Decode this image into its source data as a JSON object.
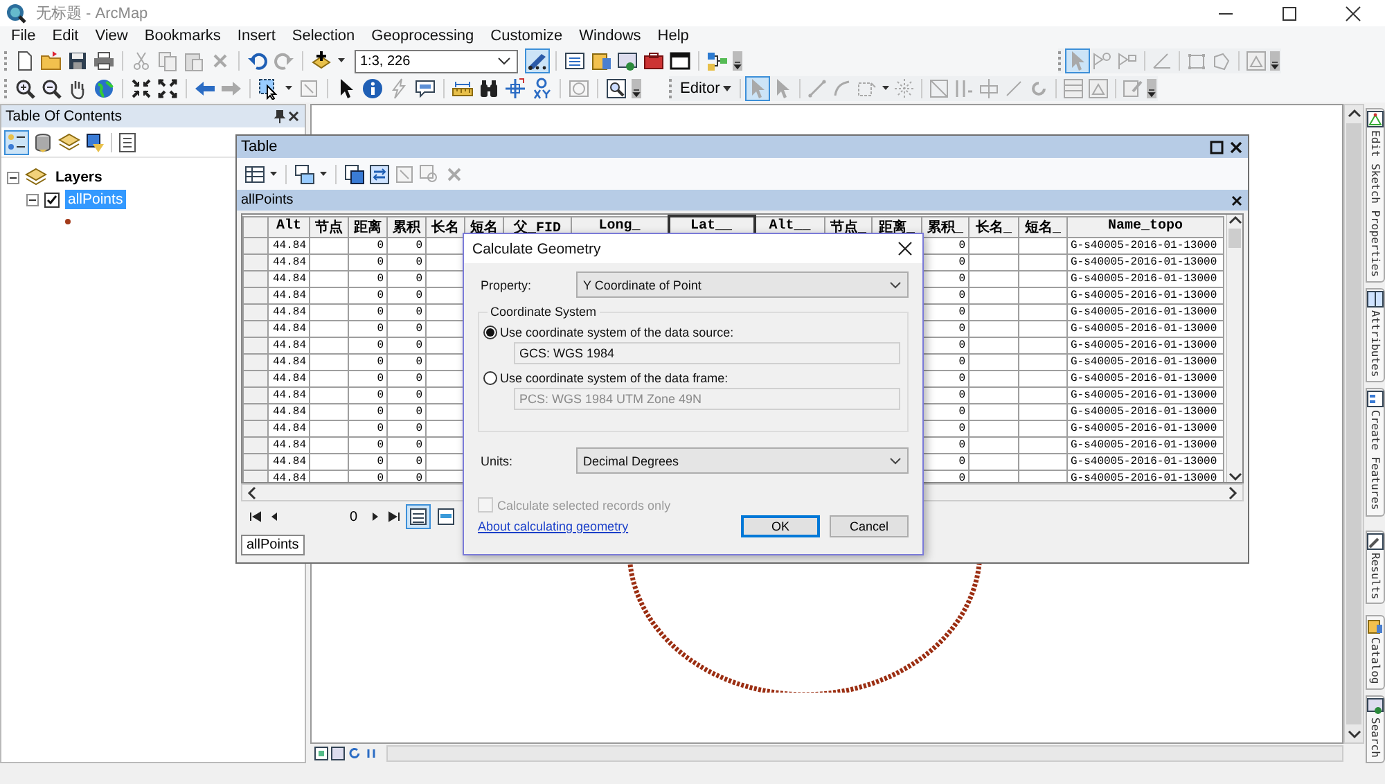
{
  "window": {
    "title": "无标题 - ArcMap"
  },
  "menu": [
    "File",
    "Edit",
    "View",
    "Bookmarks",
    "Insert",
    "Selection",
    "Geoprocessing",
    "Customize",
    "Windows",
    "Help"
  ],
  "toolbar": {
    "scale": "1:3, 226",
    "editor_toolbar_pressed": true,
    "editor_menu": "Editor",
    "edit_tool_pressed": true,
    "sketch_select_pressed": true
  },
  "toc": {
    "title": "Table Of Contents",
    "view_buttons": [
      {
        "selected": true
      },
      {
        "selected": false
      },
      {
        "selected": false
      },
      {
        "selected": false
      },
      {
        "selected": false
      }
    ],
    "tree": [
      {
        "label": "Layers",
        "expanded": true,
        "children": [
          {
            "label": "allPoints",
            "checked": true,
            "selected": true,
            "expanded": true
          }
        ]
      }
    ]
  },
  "table": {
    "title": "Table",
    "layer": "allPoints",
    "columns": [
      {
        "label": "Alt",
        "selected": false
      },
      {
        "label": "节点",
        "selected": false
      },
      {
        "label": "距离",
        "selected": false
      },
      {
        "label": "累积",
        "selected": false
      },
      {
        "label": "长名",
        "selected": false
      },
      {
        "label": "短名",
        "selected": false
      },
      {
        "label": "父_FID",
        "selected": false
      },
      {
        "label": "Long_",
        "selected": false
      },
      {
        "label": "Lat__",
        "selected": true
      },
      {
        "label": "Alt__",
        "selected": false
      },
      {
        "label": "节点_",
        "selected": false
      },
      {
        "label": "距离_",
        "selected": false
      },
      {
        "label": "累积_",
        "selected": false
      },
      {
        "label": "长名_",
        "selected": false
      },
      {
        "label": "短名_",
        "selected": false
      },
      {
        "label": "Name_topo",
        "selected": false
      }
    ],
    "rows": [
      {
        "alt": "44.84",
        "distance": "0",
        "cumulative": "0",
        "cumulative_2": "0",
        "name_topo": "G-s40005-2016-01-13000"
      },
      {
        "alt": "44.84",
        "distance": "0",
        "cumulative": "0",
        "cumulative_2": "0",
        "name_topo": "G-s40005-2016-01-13000"
      },
      {
        "alt": "44.84",
        "distance": "0",
        "cumulative": "0",
        "cumulative_2": "0",
        "name_topo": "G-s40005-2016-01-13000"
      },
      {
        "alt": "44.84",
        "distance": "0",
        "cumulative": "0",
        "cumulative_2": "0",
        "name_topo": "G-s40005-2016-01-13000"
      },
      {
        "alt": "44.84",
        "distance": "0",
        "cumulative": "0",
        "cumulative_2": "0",
        "name_topo": "G-s40005-2016-01-13000"
      },
      {
        "alt": "44.84",
        "distance": "0",
        "cumulative": "0",
        "cumulative_2": "0",
        "name_topo": "G-s40005-2016-01-13000"
      },
      {
        "alt": "44.84",
        "distance": "0",
        "cumulative": "0",
        "cumulative_2": "0",
        "name_topo": "G-s40005-2016-01-13000"
      },
      {
        "alt": "44.84",
        "distance": "0",
        "cumulative": "0",
        "cumulative_2": "0",
        "name_topo": "G-s40005-2016-01-13000"
      },
      {
        "alt": "44.84",
        "distance": "0",
        "cumulative": "0",
        "cumulative_2": "0",
        "name_topo": "G-s40005-2016-01-13000"
      },
      {
        "alt": "44.84",
        "distance": "0",
        "cumulative": "0",
        "cumulative_2": "0",
        "name_topo": "G-s40005-2016-01-13000"
      },
      {
        "alt": "44.84",
        "distance": "0",
        "cumulative": "0",
        "cumulative_2": "0",
        "name_topo": "G-s40005-2016-01-13000"
      },
      {
        "alt": "44.84",
        "distance": "0",
        "cumulative": "0",
        "cumulative_2": "0",
        "name_topo": "G-s40005-2016-01-13000"
      },
      {
        "alt": "44.84",
        "distance": "0",
        "cumulative": "0",
        "cumulative_2": "0",
        "name_topo": "G-s40005-2016-01-13000"
      },
      {
        "alt": "44.84",
        "distance": "0",
        "cumulative": "0",
        "cumulative_2": "0",
        "name_topo": "G-s40005-2016-01-13000"
      },
      {
        "alt": "44.84",
        "distance": "0",
        "cumulative": "0",
        "cumulative_2": "0",
        "name_topo": "G-s40005-2016-01-13000"
      }
    ],
    "record": "0",
    "show_all_selected": true,
    "tabs": [
      {
        "label": "allPoints",
        "selected": true
      }
    ]
  },
  "dialog": {
    "title": "Calculate Geometry",
    "property_label": "Property:",
    "property": "Y Coordinate of Point",
    "group_title": "Coordinate System",
    "options": [
      {
        "label": "Use coordinate system of the data source:",
        "selected": true,
        "value": "GCS: WGS 1984",
        "disabled": false
      },
      {
        "label": "Use coordinate system of the data frame:",
        "selected": false,
        "value": "PCS: WGS 1984 UTM Zone 49N",
        "disabled": true
      }
    ],
    "units_label": "Units:",
    "units": "Decimal Degrees",
    "selected_only": {
      "label": "Calculate selected records only",
      "checked": false,
      "disabled": true
    },
    "help_link": "About calculating geometry",
    "buttons": [
      {
        "label": "OK",
        "default": true
      },
      {
        "label": "Cancel",
        "default": false
      }
    ]
  },
  "dock_tabs": [
    "Edit Sketch Properties",
    "Attributes",
    "Create Features",
    "Results",
    "Catalog",
    "Search"
  ]
}
